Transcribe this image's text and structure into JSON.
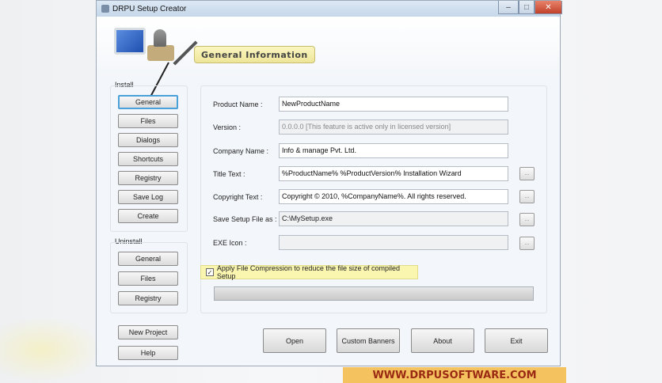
{
  "window": {
    "title": "DRPU Setup Creator",
    "minimize": "–",
    "maximize": "□",
    "close": "✕"
  },
  "banner": {
    "heading": "General Information"
  },
  "install": {
    "label": "Install",
    "buttons": [
      "General",
      "Files",
      "Dialogs",
      "Shortcuts",
      "Registry",
      "Save Log",
      "Create"
    ]
  },
  "uninstall": {
    "label": "Uninstall",
    "buttons": [
      "General",
      "Files",
      "Registry"
    ]
  },
  "side_buttons": {
    "new_project": "New Project",
    "help": "Help"
  },
  "form": {
    "fields": [
      {
        "label": "Product Name :",
        "value": "NewProductName",
        "disabled": false,
        "browse": false
      },
      {
        "label": "Version :",
        "value": "0.0.0.0 [This feature is active only in licensed version]",
        "disabled": true,
        "browse": false
      },
      {
        "label": "Company Name :",
        "value": "Info & manage Pvt. Ltd.",
        "disabled": false,
        "browse": false
      },
      {
        "label": "Title Text :",
        "value": "%ProductName% %ProductVersion% Installation Wizard",
        "disabled": false,
        "browse": true
      },
      {
        "label": "Copyright Text :",
        "value": "Copyright © 2010, %CompanyName%. All rights reserved.",
        "disabled": false,
        "browse": true
      },
      {
        "label": "Save Setup File as :",
        "value": "C:\\MySetup.exe",
        "disabled": true,
        "browse": true
      },
      {
        "label": "EXE Icon :",
        "value": "",
        "disabled": true,
        "browse": true
      }
    ],
    "browse_label": "...",
    "compression": {
      "label": "Apply File Compression to reduce the file size of compiled Setup",
      "checked": true,
      "mark": "✓"
    },
    "progress": 0
  },
  "bottom_buttons": {
    "open": "Open",
    "custom_banners": "Custom Banners",
    "about": "About",
    "exit": "Exit"
  },
  "watermark": "WWW.DRPUSOFTWARE.COM"
}
